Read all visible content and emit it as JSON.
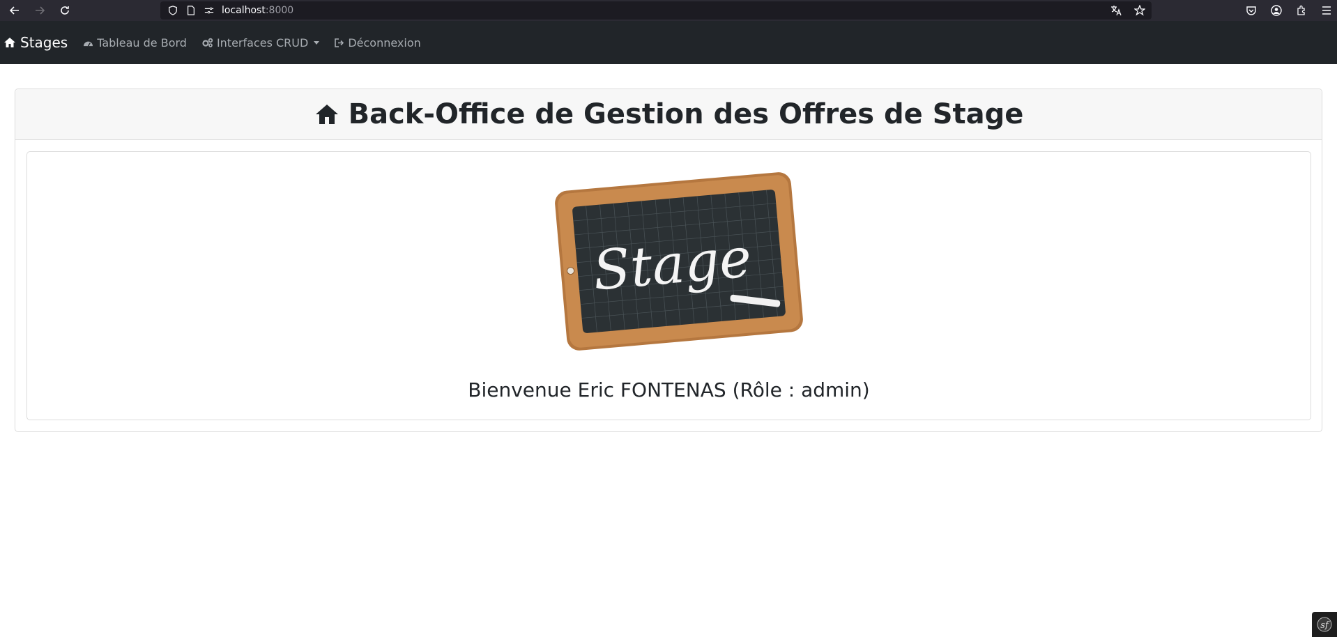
{
  "browser": {
    "url_host": "localhost",
    "url_port": ":8000"
  },
  "navbar": {
    "brand": "Stages",
    "links": [
      {
        "label": "Tableau de Bord",
        "icon": "dashboard-icon"
      },
      {
        "label": "Interfaces CRUD",
        "icon": "cogs-icon",
        "dropdown": true
      },
      {
        "label": "Déconnexion",
        "icon": "sign-out-icon"
      }
    ]
  },
  "card": {
    "title": "Back-Office de Gestion des Offres de Stage",
    "image_text": "Stage",
    "welcome": "Bienvenue Eric FONTENAS (Rôle : admin)"
  },
  "colors": {
    "navbar_bg": "#212529",
    "browser_bg": "#2b2a33",
    "card_header_bg": "#f7f7f7"
  }
}
